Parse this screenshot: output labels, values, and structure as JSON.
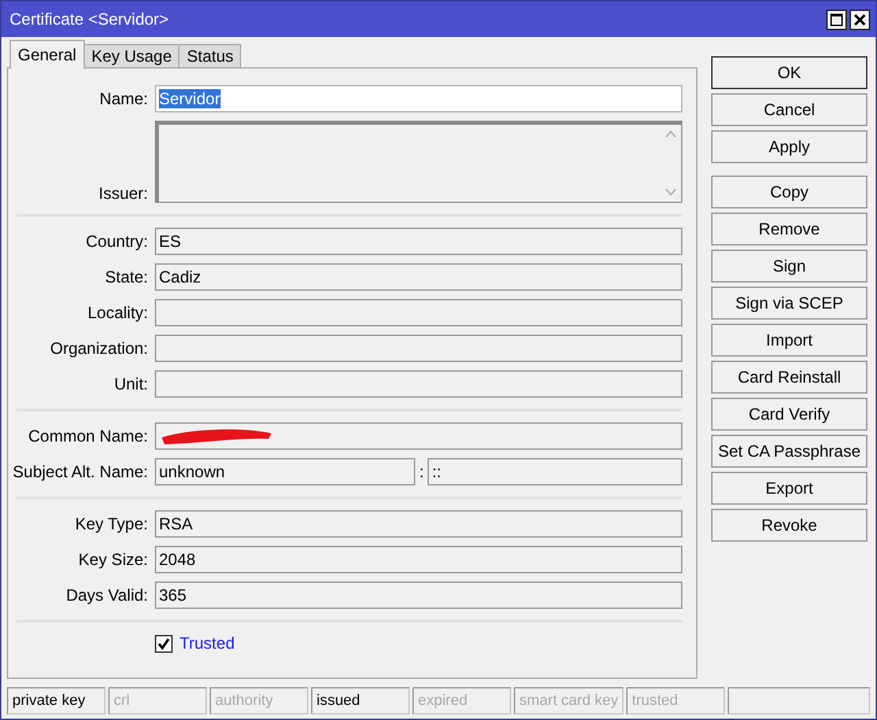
{
  "window": {
    "title": "Certificate <Servidor>"
  },
  "tabs": [
    {
      "label": "General",
      "selected": true
    },
    {
      "label": "Key Usage",
      "selected": false
    },
    {
      "label": "Status",
      "selected": false
    }
  ],
  "form": {
    "groups": [
      [
        {
          "kind": "text",
          "label": "Name:",
          "value": "Servidor",
          "editable": true,
          "value_selected": true
        },
        {
          "kind": "textarea",
          "label": "Issuer:",
          "editable": false
        }
      ],
      [
        {
          "kind": "text",
          "label": "Country:",
          "value": "ES",
          "editable": false
        },
        {
          "kind": "text",
          "label": "State:",
          "value": "Cadiz",
          "editable": false
        },
        {
          "kind": "text",
          "label": "Locality:",
          "editable": false
        },
        {
          "kind": "text",
          "label": "Organization:",
          "editable": false
        },
        {
          "kind": "text",
          "label": "Unit:",
          "editable": false
        }
      ],
      [
        {
          "kind": "text",
          "label": "Common Name:",
          "editable": false,
          "redacted": true
        },
        {
          "kind": "split",
          "label": "Subject Alt. Name:",
          "value": "unknown",
          "separator": ":",
          "value_2": "::",
          "editable": false
        }
      ],
      [
        {
          "kind": "text",
          "label": "Key Type:",
          "value": "RSA",
          "editable": false
        },
        {
          "kind": "text",
          "label": "Key Size:",
          "value": "2048",
          "editable": false
        },
        {
          "kind": "text",
          "label": "Days Valid:",
          "value": "365",
          "editable": false
        }
      ],
      [
        {
          "kind": "checkbox",
          "label": "Trusted",
          "checked": true
        }
      ]
    ]
  },
  "buttons": [
    [
      {
        "label": "OK",
        "default": true
      },
      {
        "label": "Cancel",
        "default": false
      },
      {
        "label": "Apply",
        "default": false
      }
    ],
    [
      {
        "label": "Copy",
        "default": false
      },
      {
        "label": "Remove",
        "default": false
      },
      {
        "label": "Sign",
        "default": false
      },
      {
        "label": "Sign via SCEP",
        "default": false
      },
      {
        "label": "Import",
        "default": false
      },
      {
        "label": "Card Reinstall",
        "default": false
      },
      {
        "label": "Card Verify",
        "default": false
      },
      {
        "label": "Set CA Passphrase",
        "default": false
      },
      {
        "label": "Export",
        "default": false
      },
      {
        "label": "Revoke",
        "default": false
      }
    ]
  ],
  "status_bar": [
    {
      "label": "private key",
      "on": true
    },
    {
      "label": "crl",
      "on": false
    },
    {
      "label": "authority",
      "on": false
    },
    {
      "label": "issued",
      "on": true
    },
    {
      "label": "expired",
      "on": false
    },
    {
      "label": "smart card key",
      "on": false
    },
    {
      "label": "trusted",
      "on": false
    }
  ]
}
